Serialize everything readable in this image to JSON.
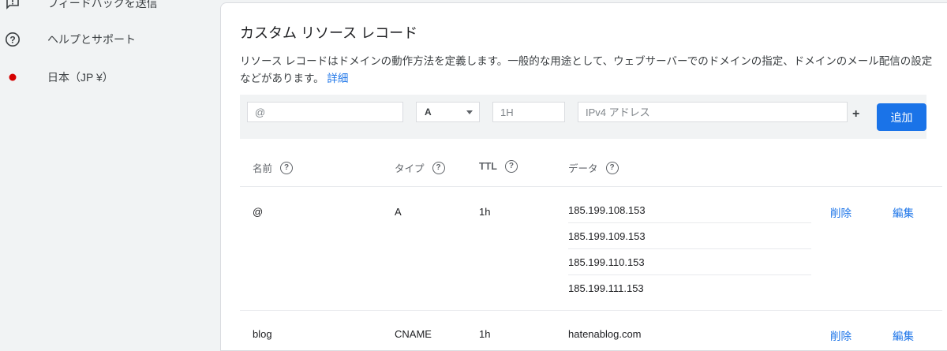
{
  "sidebar": {
    "items": [
      {
        "label": "フィードバックを送信",
        "icon": "feedback-icon"
      },
      {
        "label": "ヘルプとサポート",
        "icon": "help-icon"
      },
      {
        "label": "日本（JP ¥）",
        "icon": "japan-flag-icon"
      }
    ]
  },
  "card": {
    "title": "カスタム リソース レコード",
    "description": "リソース レコードはドメインの動作方法を定義します。一般的な用途として、ウェブサーバーでのドメインの指定、ドメインのメール配信の設定などがあります。",
    "learn_more": "詳細"
  },
  "form": {
    "name_placeholder": "@",
    "type_value": "A",
    "ttl_placeholder": "1H",
    "data_placeholder": "IPv4 アドレス",
    "plus": "+",
    "add_label": "追加"
  },
  "table": {
    "headers": {
      "name": "名前",
      "type": "タイプ",
      "ttl": "TTL",
      "data": "データ"
    },
    "help_glyph": "?",
    "rows": [
      {
        "name": "@",
        "type": "A",
        "ttl": "1h",
        "data": [
          "185.199.108.153",
          "185.199.109.153",
          "185.199.110.153",
          "185.199.111.153"
        ],
        "delete": "削除",
        "edit": "編集"
      },
      {
        "name": "blog",
        "type": "CNAME",
        "ttl": "1h",
        "data": [
          "hatenablog.com"
        ],
        "delete": "削除",
        "edit": "編集"
      }
    ]
  },
  "colors": {
    "accent": "#1a73e8",
    "flag_red": "#d50000"
  }
}
